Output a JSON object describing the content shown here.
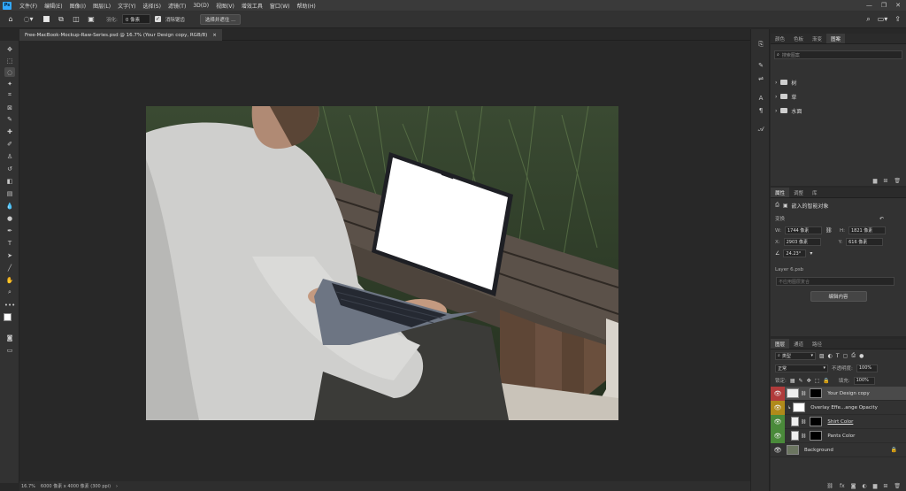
{
  "app": {
    "logo": "Ps"
  },
  "menu": [
    "文件(F)",
    "编辑(E)",
    "图像(I)",
    "图层(L)",
    "文字(Y)",
    "选择(S)",
    "滤镜(T)",
    "3D(D)",
    "视图(V)",
    "增效工具",
    "窗口(W)",
    "帮助(H)"
  ],
  "options": {
    "feather_label": "羽化:",
    "feather_value": "0 像素",
    "antialias_label": "消除锯齿",
    "select_subject_button": "选择并遮住 ..."
  },
  "document": {
    "tab_title": "Free-MacBook-Mockup-Raw-Series.psd @ 16.7% (Your Design copy, RGB/8)",
    "close": "×"
  },
  "status": {
    "zoom": "16.7%",
    "info": "6000 像素 x 4000 像素 (300 ppi)",
    "arrow": "›"
  },
  "colors_panel": {
    "tabs": [
      "颜色",
      "色板",
      "渐变",
      "图案"
    ],
    "search_placeholder": "搜索图案",
    "folders": [
      "树",
      "草",
      "水面"
    ]
  },
  "properties_panel": {
    "tabs": [
      "属性",
      "调整",
      "库"
    ],
    "object_type": "嵌入的智能对象",
    "transform_label": "变换",
    "w_label": "W:",
    "w_value": "1744 像素",
    "h_label": "H:",
    "h_value": "1821 像素",
    "x_label": "X:",
    "x_value": "2903 像素",
    "y_label": "Y:",
    "y_value": "616 像素",
    "angle_value": "24.23°",
    "file_name": "Layer 6.psb",
    "comp_placeholder": "不应用图层复合",
    "edit_button": "编辑内容"
  },
  "layers_panel": {
    "tabs": [
      "图层",
      "通道",
      "路径"
    ],
    "filter_kind": "类型",
    "blend_mode": "正常",
    "opacity_label": "不透明度:",
    "opacity_value": "100%",
    "lock_label": "锁定:",
    "fill_label": "填充:",
    "fill_value": "100%",
    "layers": [
      {
        "name": "Your Design copy",
        "eye_color": "#b03b3b",
        "selected": true
      },
      {
        "name": "Overlay Effe...ange Opacity",
        "eye_color": "#b08a1a",
        "selected": false
      },
      {
        "name": "Shirt Color",
        "eye_color": "#4a8a3a",
        "selected": false
      },
      {
        "name": "Pants Color",
        "eye_color": "#4a8a3a",
        "selected": false
      },
      {
        "name": "Background",
        "eye_color": "#323232",
        "selected": false
      }
    ]
  },
  "theme": {
    "accent": "#31a8ff",
    "panel_bg": "#323232",
    "canvas_bg": "#282828"
  }
}
